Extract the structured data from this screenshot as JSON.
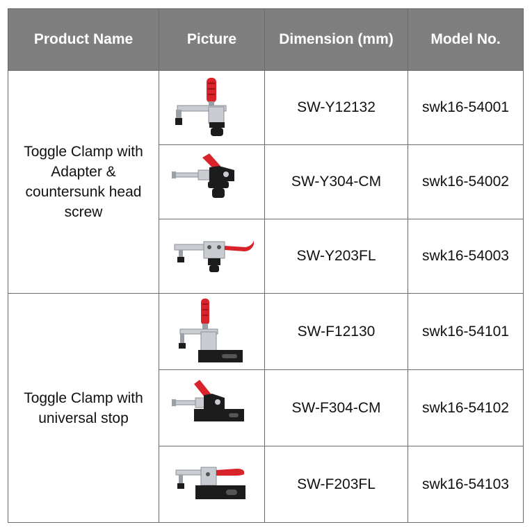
{
  "table": {
    "headers": [
      "Product Name",
      "Picture",
      "Dimension (mm)",
      "Model No."
    ],
    "groups": [
      {
        "name_lines": [
          "Toggle Clamp  with",
          "Adapter &",
          "countersunk head",
          "screw"
        ],
        "rows": [
          {
            "picture": "vertical-toggle-clamp-adapter-icon",
            "dimension": "SW-Y12132",
            "model": "swk16-54001"
          },
          {
            "picture": "push-pull-toggle-clamp-adapter-icon",
            "dimension": "SW-Y304-CM",
            "model": "swk16-54002"
          },
          {
            "picture": "horizontal-toggle-clamp-adapter-icon",
            "dimension": "SW-Y203FL",
            "model": "swk16-54003"
          }
        ]
      },
      {
        "name_lines": [
          "Toggle Clamp  with",
          "universal stop"
        ],
        "rows": [
          {
            "picture": "vertical-toggle-clamp-stop-icon",
            "dimension": "SW-F12130",
            "model": "swk16-54101"
          },
          {
            "picture": "push-pull-toggle-clamp-stop-icon",
            "dimension": "SW-F304-CM",
            "model": "swk16-54102"
          },
          {
            "picture": "horizontal-toggle-clamp-stop-icon",
            "dimension": "SW-F203FL",
            "model": "swk16-54103"
          }
        ]
      }
    ]
  },
  "colors": {
    "header_bg": "#7f7f7f",
    "header_text": "#ffffff",
    "border": "#6a6a6a",
    "handle_red": "#d8232a",
    "steel": "#c9cdd2",
    "base_black": "#1c1c1c"
  }
}
